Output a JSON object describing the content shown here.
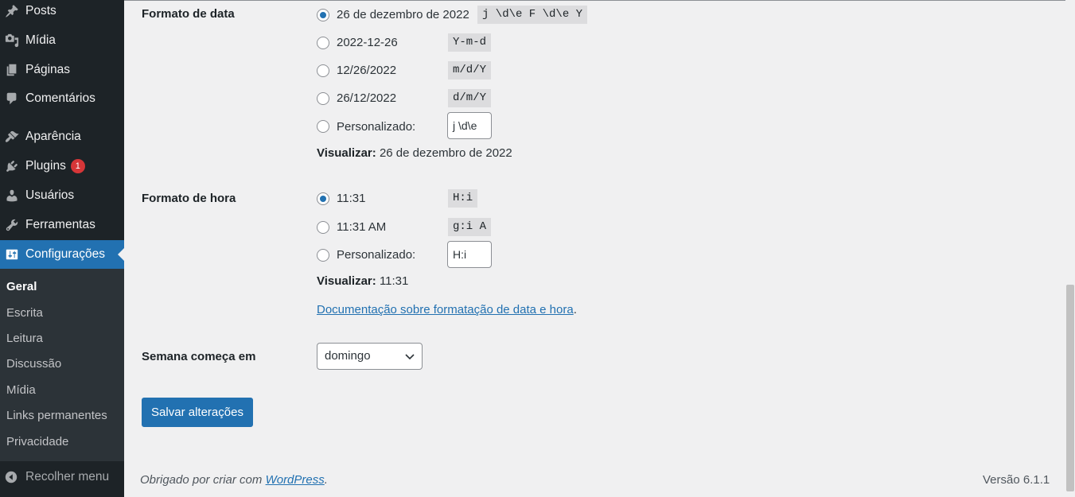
{
  "sidebar": {
    "menu": [
      {
        "label": "Posts",
        "icon": "pin-icon"
      },
      {
        "label": "Mídia",
        "icon": "media-icon"
      },
      {
        "label": "Páginas",
        "icon": "pages-icon"
      },
      {
        "label": "Comentários",
        "icon": "comments-icon"
      },
      {
        "label": "Aparência",
        "icon": "paintbrush-icon"
      },
      {
        "label": "Plugins",
        "icon": "plugins-icon",
        "badge": "1"
      },
      {
        "label": "Usuários",
        "icon": "users-icon"
      },
      {
        "label": "Ferramentas",
        "icon": "wrench-icon"
      },
      {
        "label": "Configurações",
        "icon": "settings-icon",
        "active": true
      }
    ],
    "submenu": [
      "Geral",
      "Escrita",
      "Leitura",
      "Discussão",
      "Mídia",
      "Links permanentes",
      "Privacidade"
    ],
    "submenu_current": "Geral",
    "collapse_label": "Recolher menu"
  },
  "date_format": {
    "label": "Formato de data",
    "options": [
      {
        "label": "26 de dezembro de 2022",
        "code": "j \\d\\e F \\d\\e Y",
        "checked": true
      },
      {
        "label": "2022-12-26",
        "code": "Y-m-d",
        "checked": false
      },
      {
        "label": "12/26/2022",
        "code": "m/d/Y",
        "checked": false
      },
      {
        "label": "26/12/2022",
        "code": "d/m/Y",
        "checked": false
      }
    ],
    "custom_label": "Personalizado:",
    "custom_value": "j \\d\\e",
    "preview_label": "Visualizar:",
    "preview_value": "26 de dezembro de 2022"
  },
  "time_format": {
    "label": "Formato de hora",
    "options": [
      {
        "label": "11:31",
        "code": "H:i",
        "checked": true
      },
      {
        "label": "11:31 AM",
        "code": "g:i A",
        "checked": false
      }
    ],
    "custom_label": "Personalizado:",
    "custom_value": "H:i",
    "preview_label": "Visualizar:",
    "preview_value": "11:31"
  },
  "doc_link": {
    "text": "Documentação sobre formatação de data e hora",
    "suffix": "."
  },
  "week_start": {
    "label": "Semana começa em",
    "selected": "domingo"
  },
  "save_button": "Salvar alterações",
  "footer": {
    "thanks": "Obrigado por criar com ",
    "link": "WordPress",
    "thanks_suffix": ".",
    "version": "Versão 6.1.1"
  },
  "colors": {
    "sidebar_bg": "#1d2327",
    "accent": "#2271b1",
    "badge": "#d63638",
    "page_bg": "#f0f0f1"
  }
}
